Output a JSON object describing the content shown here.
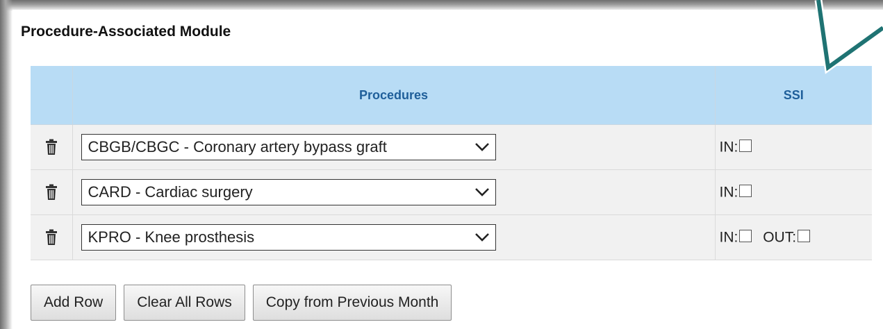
{
  "module": {
    "title": "Procedure-Associated Module"
  },
  "table": {
    "headers": {
      "procedures": "Procedures",
      "ssi": "SSI"
    },
    "rows": [
      {
        "procedure": "CBGB/CBGC - Coronary artery bypass graft",
        "ssi_fields": [
          {
            "label": "IN:",
            "checked": false
          }
        ]
      },
      {
        "procedure": "CARD - Cardiac surgery",
        "ssi_fields": [
          {
            "label": "IN:",
            "checked": false
          }
        ]
      },
      {
        "procedure": "KPRO - Knee prosthesis",
        "ssi_fields": [
          {
            "label": "IN:",
            "checked": false
          },
          {
            "label": "OUT:",
            "checked": false
          }
        ]
      }
    ]
  },
  "buttons": {
    "add_row": "Add Row",
    "clear_all_rows": "Clear All Rows",
    "copy_previous": "Copy from Previous Month"
  },
  "colors": {
    "header_background": "#b8dcf5",
    "header_text": "#1f5f9a",
    "row_background": "#f1f1f1",
    "callout_stroke": "#1f7373"
  }
}
